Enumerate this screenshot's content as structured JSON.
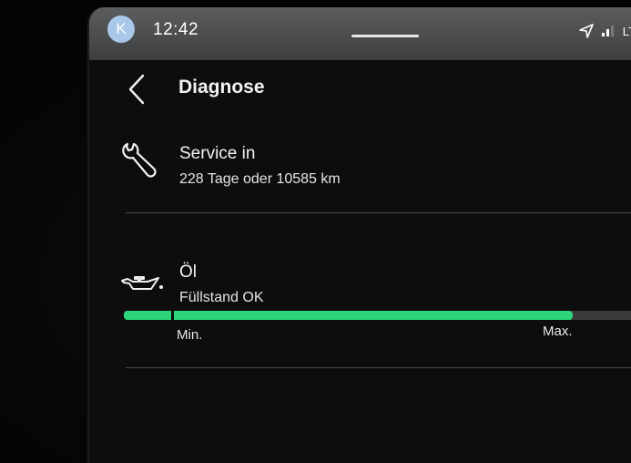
{
  "status_bar": {
    "avatar_letter": "K",
    "time": "12:42",
    "network": "LT"
  },
  "header": {
    "title": "Diagnose"
  },
  "service": {
    "icon": "wrench-icon",
    "title": "Service in",
    "detail": "228 Tage oder 10585 km"
  },
  "oil": {
    "icon": "oil-can-icon",
    "title": "Öl",
    "status": "Füllstand OK",
    "level_fraction": 0.88,
    "min_label": "Min.",
    "max_label": "Max."
  },
  "colors": {
    "accent": "#2ed47a",
    "background": "#0d0d0d",
    "status_bar": "#4a4c4e"
  }
}
